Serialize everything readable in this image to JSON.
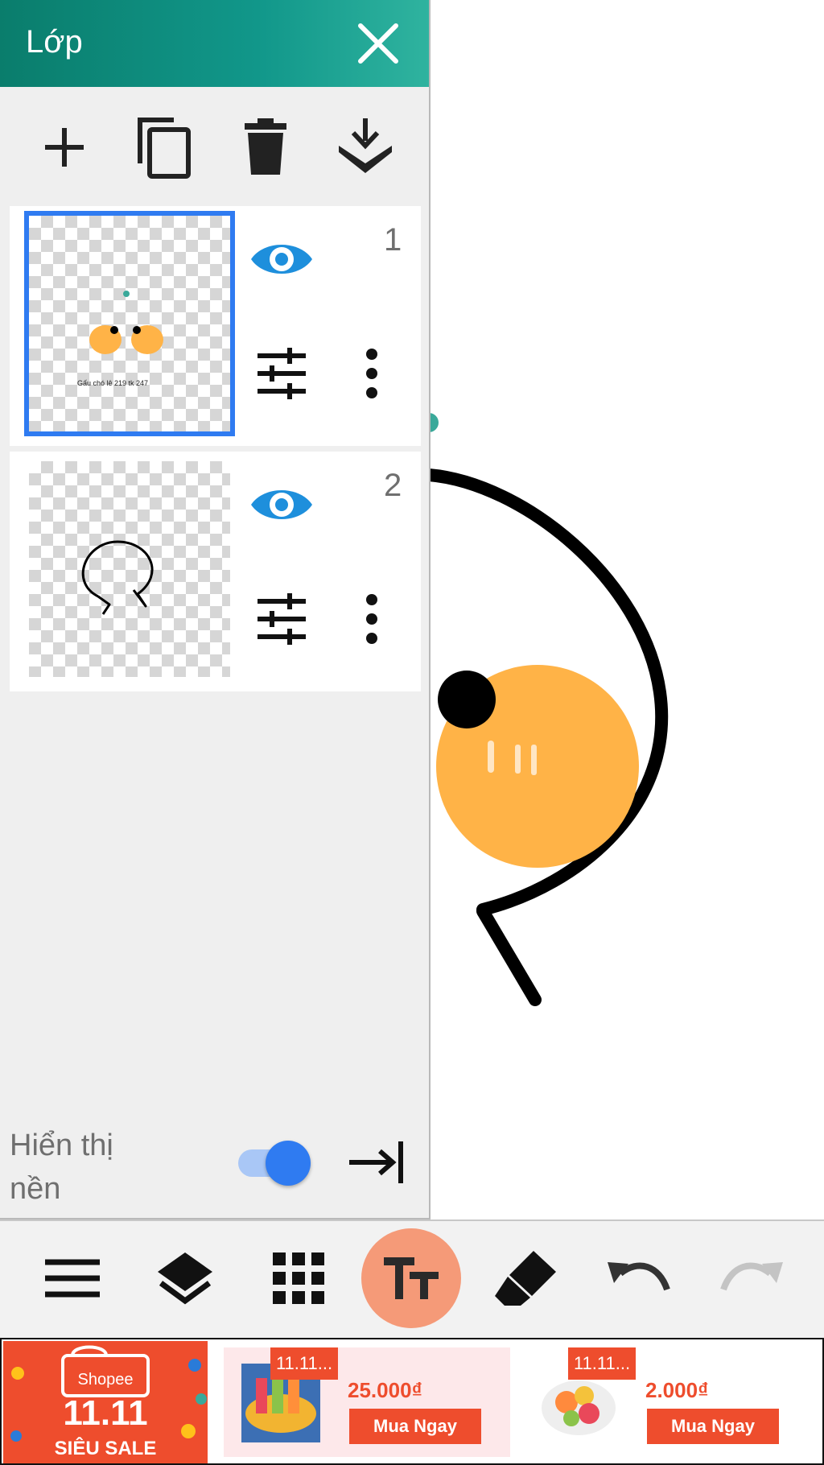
{
  "panel": {
    "title": "Lớp",
    "toolbar_icons": [
      "plus-icon",
      "duplicate-icon",
      "trash-icon",
      "merge-down-icon"
    ],
    "layers": [
      {
        "number": "1",
        "visible": true,
        "selected": true,
        "thumb_text": "Gấu chó lê 219 tk 247"
      },
      {
        "number": "2",
        "visible": true,
        "selected": false
      }
    ],
    "background_label": "Hiển thị nền",
    "background_toggle": true
  },
  "bottom_toolbar": {
    "icons": [
      "menu-icon",
      "layers-icon",
      "grid-icon",
      "text-icon",
      "eraser-icon",
      "undo-icon",
      "redo-icon"
    ],
    "active": "text-icon"
  },
  "ad": {
    "brand": "Shopee",
    "event": "11.11",
    "event_label": "SIÊU SALE",
    "products": [
      {
        "badge": "11.11...",
        "price": "25.000₫",
        "button": "Mua Ngay"
      },
      {
        "badge": "11.11...",
        "price": "2.000₫",
        "button": "Mua Ngay"
      }
    ]
  },
  "colors": {
    "accent": "#11978a",
    "selection": "#2f7bf1",
    "text_tool": "#f59a78",
    "shopee": "#ee4d2d",
    "bun": "#ffb347"
  }
}
